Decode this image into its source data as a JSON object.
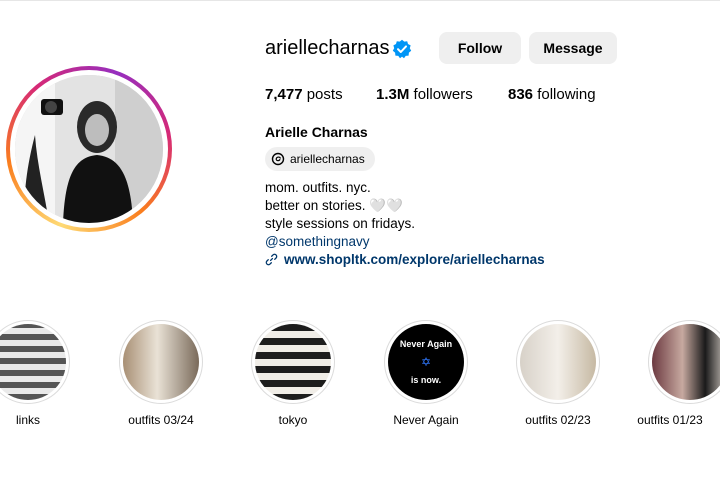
{
  "profile": {
    "username": "ariellecharnas",
    "full_name": "Arielle Charnas",
    "verified": true,
    "follow_label": "Follow",
    "message_label": "Message",
    "stats": {
      "posts_count": "7,477",
      "posts_label": "posts",
      "followers_count": "1.3M",
      "followers_label": "followers",
      "following_count": "836",
      "following_label": "following"
    },
    "threads_handle": "ariellecharnas",
    "bio": {
      "line1": "mom. outfits. nyc.",
      "line2": "better on stories. 🤍🤍",
      "line3": "style sessions on fridays.",
      "mention": "@somethingnavy"
    },
    "link": "www.shopltk.com/explore/ariellecharnas"
  },
  "highlights": [
    {
      "label": "links",
      "icon": "photo"
    },
    {
      "label": "outfits 03/24",
      "icon": "photo"
    },
    {
      "label": "tokyo",
      "icon": "photo"
    },
    {
      "label": "Never Again",
      "image_text": [
        "Never Again",
        "is now."
      ],
      "icon": "star-of-david-icon"
    },
    {
      "label": "outfits 02/23",
      "icon": "photo"
    },
    {
      "label": "outfits 01/23",
      "icon": "photo"
    }
  ],
  "colors": {
    "link": "#00376b",
    "button_bg": "#efefef",
    "verified": "#0095f6"
  }
}
